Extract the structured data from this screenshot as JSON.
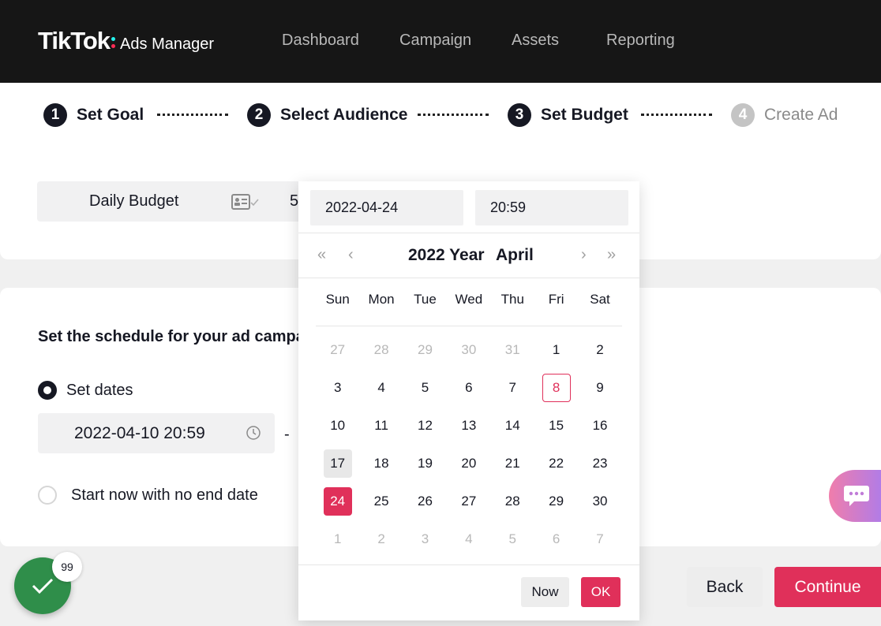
{
  "header": {
    "logo_main": "TikTok",
    "logo_sub": "Ads Manager",
    "nav": [
      "Dashboard",
      "Campaign",
      "Assets",
      "Reporting"
    ]
  },
  "steps": [
    {
      "num": "1",
      "label": "Set Goal",
      "state": "done"
    },
    {
      "num": "2",
      "label": "Select Audience",
      "state": "done"
    },
    {
      "num": "3",
      "label": "Set Budget",
      "state": "current"
    },
    {
      "num": "4",
      "label": "Create Ad",
      "state": "upcoming"
    }
  ],
  "budget": {
    "label": "Daily Budget",
    "icon": "id-card-check-icon",
    "value": "5"
  },
  "schedule": {
    "title": "Set the schedule for your ad campaign",
    "option_dates": "Set dates",
    "start_datetime": "2022-04-10 20:59",
    "separator": "-",
    "option_no_end": "Start now with no end date"
  },
  "picker": {
    "date_value": "2022-04-24",
    "time_value": "20:59",
    "year_label": "2022 Year",
    "month_label": "April",
    "nav": {
      "prev_year": "«",
      "prev_month": "‹",
      "next_month": "›",
      "next_year": "»"
    },
    "weekdays": [
      "Sun",
      "Mon",
      "Tue",
      "Wed",
      "Thu",
      "Fri",
      "Sat"
    ],
    "weeks": [
      [
        {
          "d": "27",
          "o": true
        },
        {
          "d": "28",
          "o": true
        },
        {
          "d": "29",
          "o": true
        },
        {
          "d": "30",
          "o": true
        },
        {
          "d": "31",
          "o": true
        },
        {
          "d": "1"
        },
        {
          "d": "2"
        }
      ],
      [
        {
          "d": "3"
        },
        {
          "d": "4"
        },
        {
          "d": "5"
        },
        {
          "d": "6"
        },
        {
          "d": "7"
        },
        {
          "d": "8",
          "today": true
        },
        {
          "d": "9"
        }
      ],
      [
        {
          "d": "10"
        },
        {
          "d": "11"
        },
        {
          "d": "12"
        },
        {
          "d": "13"
        },
        {
          "d": "14"
        },
        {
          "d": "15"
        },
        {
          "d": "16"
        }
      ],
      [
        {
          "d": "17",
          "hover": true
        },
        {
          "d": "18"
        },
        {
          "d": "19"
        },
        {
          "d": "20"
        },
        {
          "d": "21"
        },
        {
          "d": "22"
        },
        {
          "d": "23"
        }
      ],
      [
        {
          "d": "24",
          "selected": true
        },
        {
          "d": "25"
        },
        {
          "d": "26"
        },
        {
          "d": "27"
        },
        {
          "d": "28"
        },
        {
          "d": "29"
        },
        {
          "d": "30"
        }
      ],
      [
        {
          "d": "1",
          "o": true
        },
        {
          "d": "2",
          "o": true
        },
        {
          "d": "3",
          "o": true
        },
        {
          "d": "4",
          "o": true
        },
        {
          "d": "5",
          "o": true
        },
        {
          "d": "6",
          "o": true
        },
        {
          "d": "7",
          "o": true
        }
      ]
    ],
    "now_label": "Now",
    "ok_label": "OK"
  },
  "footer": {
    "badge_count": "99",
    "back_label": "Back",
    "continue_label": "Continue"
  },
  "colors": {
    "accent": "#e0305a",
    "header_bg": "#161616",
    "success": "#2f8e4a"
  }
}
